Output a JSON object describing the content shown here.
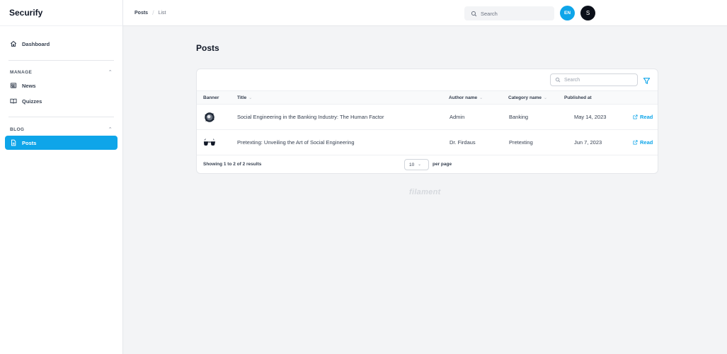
{
  "app": {
    "brand": "Securify"
  },
  "sidebar": {
    "dashboard": "Dashboard",
    "groups": [
      {
        "title": "MANAGE",
        "items": [
          "News",
          "Quizzes"
        ]
      },
      {
        "title": "BLOG",
        "items": [
          "Posts"
        ]
      }
    ]
  },
  "topbar": {
    "breadcrumb": [
      "Posts",
      "List"
    ],
    "search_placeholder": "Search",
    "language_badge": "EN",
    "avatar_initial": "S"
  },
  "page": {
    "title": "Posts"
  },
  "table": {
    "search_placeholder": "Search",
    "columns": [
      "Banner",
      "Title",
      "Author name",
      "Category name",
      "Published at"
    ],
    "rows": [
      {
        "title": "Social Engineering in the Banking Industry: The Human Factor",
        "author": "Admin",
        "category": "Banking",
        "published": "May 14, 2023",
        "action": "Read"
      },
      {
        "title": "Pretexting: Unveiling the Art of Social Engineering",
        "author": "Dr. Firdaus",
        "category": "Pretexting",
        "published": "Jun 7, 2023",
        "action": "Read"
      }
    ],
    "footer": {
      "showing": "Showing 1 to 2 of 2 results",
      "per_page_value": "10",
      "per_page_label": "per page"
    }
  },
  "watermark": "filament",
  "colors": {
    "accent": "#0ea5e9",
    "avatar": "#0b0f19"
  }
}
